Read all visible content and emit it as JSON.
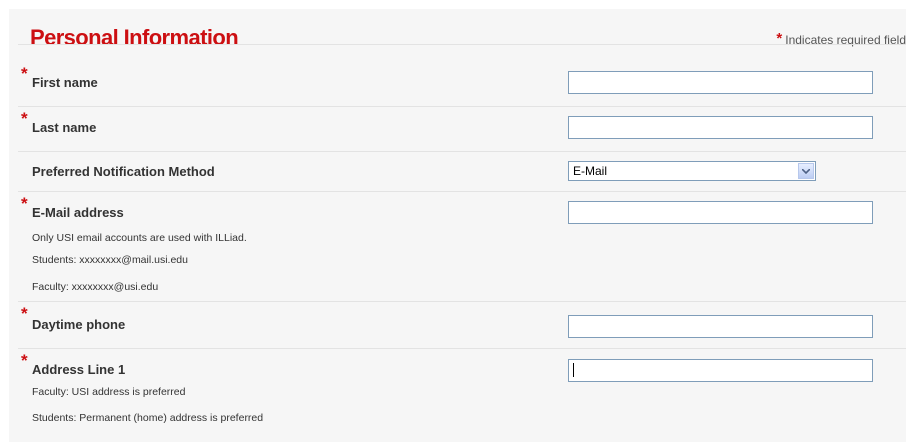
{
  "header": {
    "title": "Personal Information",
    "required_star": "*",
    "required_text": "Indicates required field"
  },
  "form": {
    "first_name": {
      "required": "*",
      "label": "First name",
      "value": ""
    },
    "last_name": {
      "required": "*",
      "label": "Last name",
      "value": ""
    },
    "notification": {
      "label": "Preferred Notification Method",
      "selected": "E-Mail"
    },
    "email": {
      "required": "*",
      "label": "E-Mail address",
      "value": "",
      "notes": [
        "Only USI email accounts are used with ILLiad.",
        "Students: xxxxxxxx@mail.usi.edu",
        "Faculty: xxxxxxxx@usi.edu"
      ]
    },
    "phone": {
      "required": "*",
      "label": "Daytime phone",
      "value": ""
    },
    "address1": {
      "required": "*",
      "label": "Address Line 1",
      "value": "",
      "notes": [
        "Faculty: USI address is preferred",
        "Students: Permanent (home) address is preferred"
      ]
    }
  },
  "colors": {
    "accent": "#cc0f12",
    "background": "#f6f6f6",
    "input_border": "#7f9db9"
  }
}
